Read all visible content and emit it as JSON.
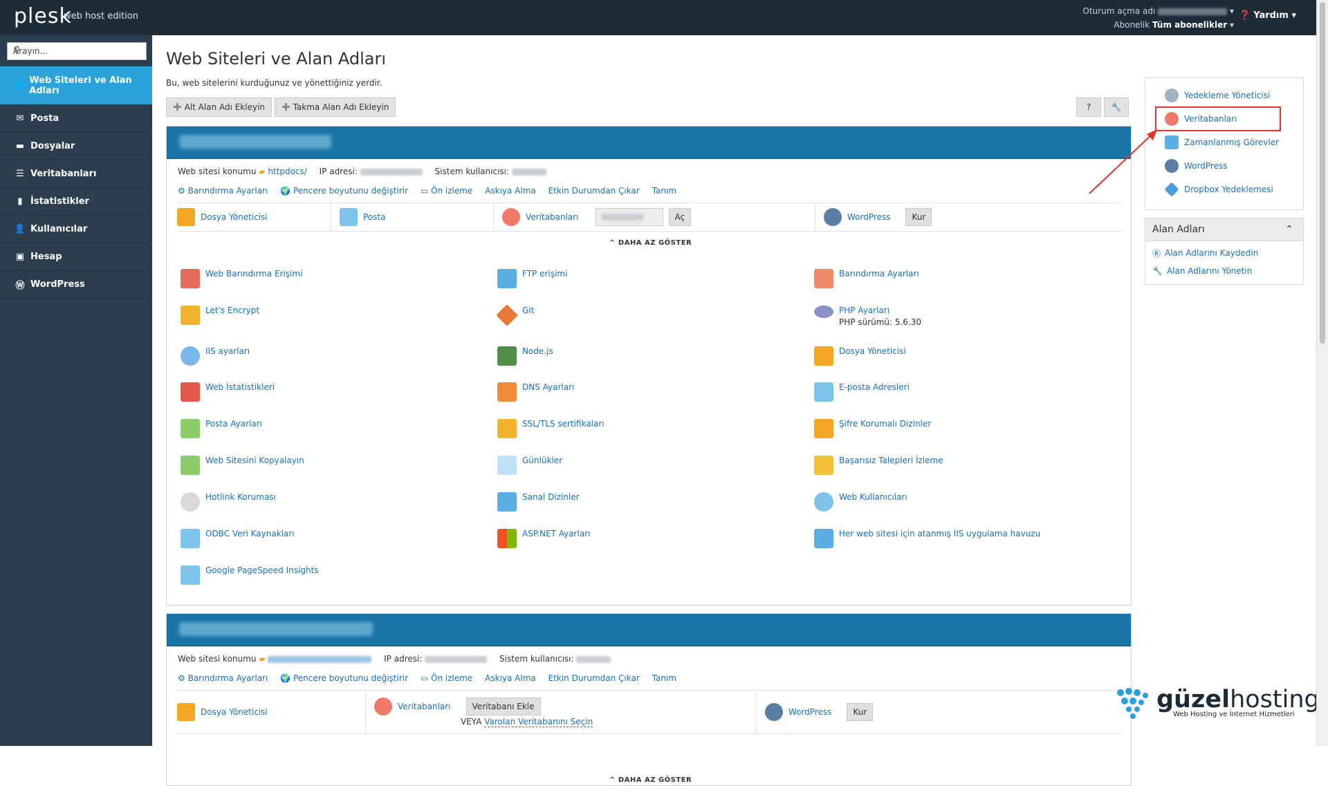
{
  "topbar": {
    "logo": "plesk",
    "edition": "web host edition",
    "login_label": "Oturum açma adı",
    "subscription_label": "Abonelik",
    "subscription_value": "Tüm abonelikler",
    "help": "Yardım"
  },
  "sidebar": {
    "search_placeholder": "Arayın...",
    "items": [
      {
        "label": "Web Siteleri ve Alan Adları"
      },
      {
        "label": "Posta"
      },
      {
        "label": "Dosyalar"
      },
      {
        "label": "Veritabanları"
      },
      {
        "label": "İstatistikler"
      },
      {
        "label": "Kullanıcılar"
      },
      {
        "label": "Hesap"
      },
      {
        "label": "WordPress"
      }
    ]
  },
  "main": {
    "title": "Web Siteleri ve Alan Adları",
    "description": "Bu, web sitelerini kurduğunuz ve yönettiğiniz yerdir.",
    "add_subdomain": "Alt Alan Adı Ekleyin",
    "add_alias": "Takma Alan Adı Ekleyin",
    "help_btn": "?"
  },
  "site1": {
    "location_label": "Web sitesi konumu",
    "location_value": "httpdocs/",
    "ip_label": "IP adresi:",
    "sysuser_label": "Sistem kullanıcısı:",
    "links": [
      "Barındırma Ayarları",
      "Pencere boyutunu değiştirir",
      "Ön izleme",
      "Askıya Alma",
      "Etkin Durumdan Çıkar",
      "Tanım"
    ],
    "tools": {
      "files": "Dosya Yöneticisi",
      "mail": "Posta",
      "db": "Veritabanları",
      "open": "Aç",
      "wp": "WordPress",
      "install": "Kur"
    },
    "show_less": "DAHA AZ GÖSTER",
    "grid": [
      [
        "Web Barındırma Erişimi",
        "FTP erişimi",
        "Barındırma Ayarları"
      ],
      [
        "Let's Encrypt",
        "Git",
        "PHP Ayarları"
      ],
      [
        "IIS ayarları",
        "Node.js",
        "Dosya Yöneticisi"
      ],
      [
        "Web İstatistikleri",
        "DNS Ayarları",
        "E-posta Adresleri"
      ],
      [
        "Posta Ayarları",
        "SSL/TLS sertifikaları",
        "Şifre Korumalı Dizinler"
      ],
      [
        "Web Sitesini Kopyalayın",
        "Günlükler",
        "Başarısız Talepleri İzleme"
      ],
      [
        "Hotlink Koruması",
        "Sanal Dizinler",
        "Web Kullanıcıları"
      ],
      [
        "ODBC Veri Kaynakları",
        "ASP.NET Ayarları",
        "Her web sitesi için atanmış IIS uygulama havuzu"
      ],
      [
        "Google PageSpeed Insights",
        "",
        ""
      ]
    ],
    "php_version": "PHP sürümü: 5.6.30"
  },
  "site2": {
    "location_label": "Web sitesi konumu",
    "ip_label": "IP adresi:",
    "sysuser_label": "Sistem kullanıcısı:",
    "links": [
      "Barındırma Ayarları",
      "Pencere boyutunu değiştirir",
      "Ön izleme",
      "Askıya Alma",
      "Etkin Durumdan Çıkar",
      "Tanım"
    ],
    "tools": {
      "files": "Dosya Yöneticisi",
      "db": "Veritabanları",
      "db_add": "Veritabanı Ekle",
      "or": "VEYA",
      "db_select": "Varolan Veritabanını Seçin",
      "wp": "WordPress",
      "install": "Kur"
    },
    "show_less": "DAHA AZ GÖSTER"
  },
  "right": {
    "items": [
      "Yedekleme Yöneticisi",
      "Veritabanları",
      "Zamanlanmış Görevler",
      "WordPress",
      "Dropbox Yedeklemesi"
    ],
    "domains_title": "Alan Adları",
    "domains_items": [
      "Alan Adlarını Kaydedin",
      "Alan Adlarını Yönetin"
    ]
  },
  "brand": {
    "name_a": "güzel",
    "name_b": "hosting",
    "tagline": "Web Hosting ve İnternet Hizmetleri"
  },
  "colors": {
    "topbar": "#1e2c37",
    "sidebar": "#2c3e4d",
    "active": "#29a3d9",
    "panel_head": "#1a73a6",
    "link": "#1a6fb5",
    "highlight": "#e4302b"
  }
}
